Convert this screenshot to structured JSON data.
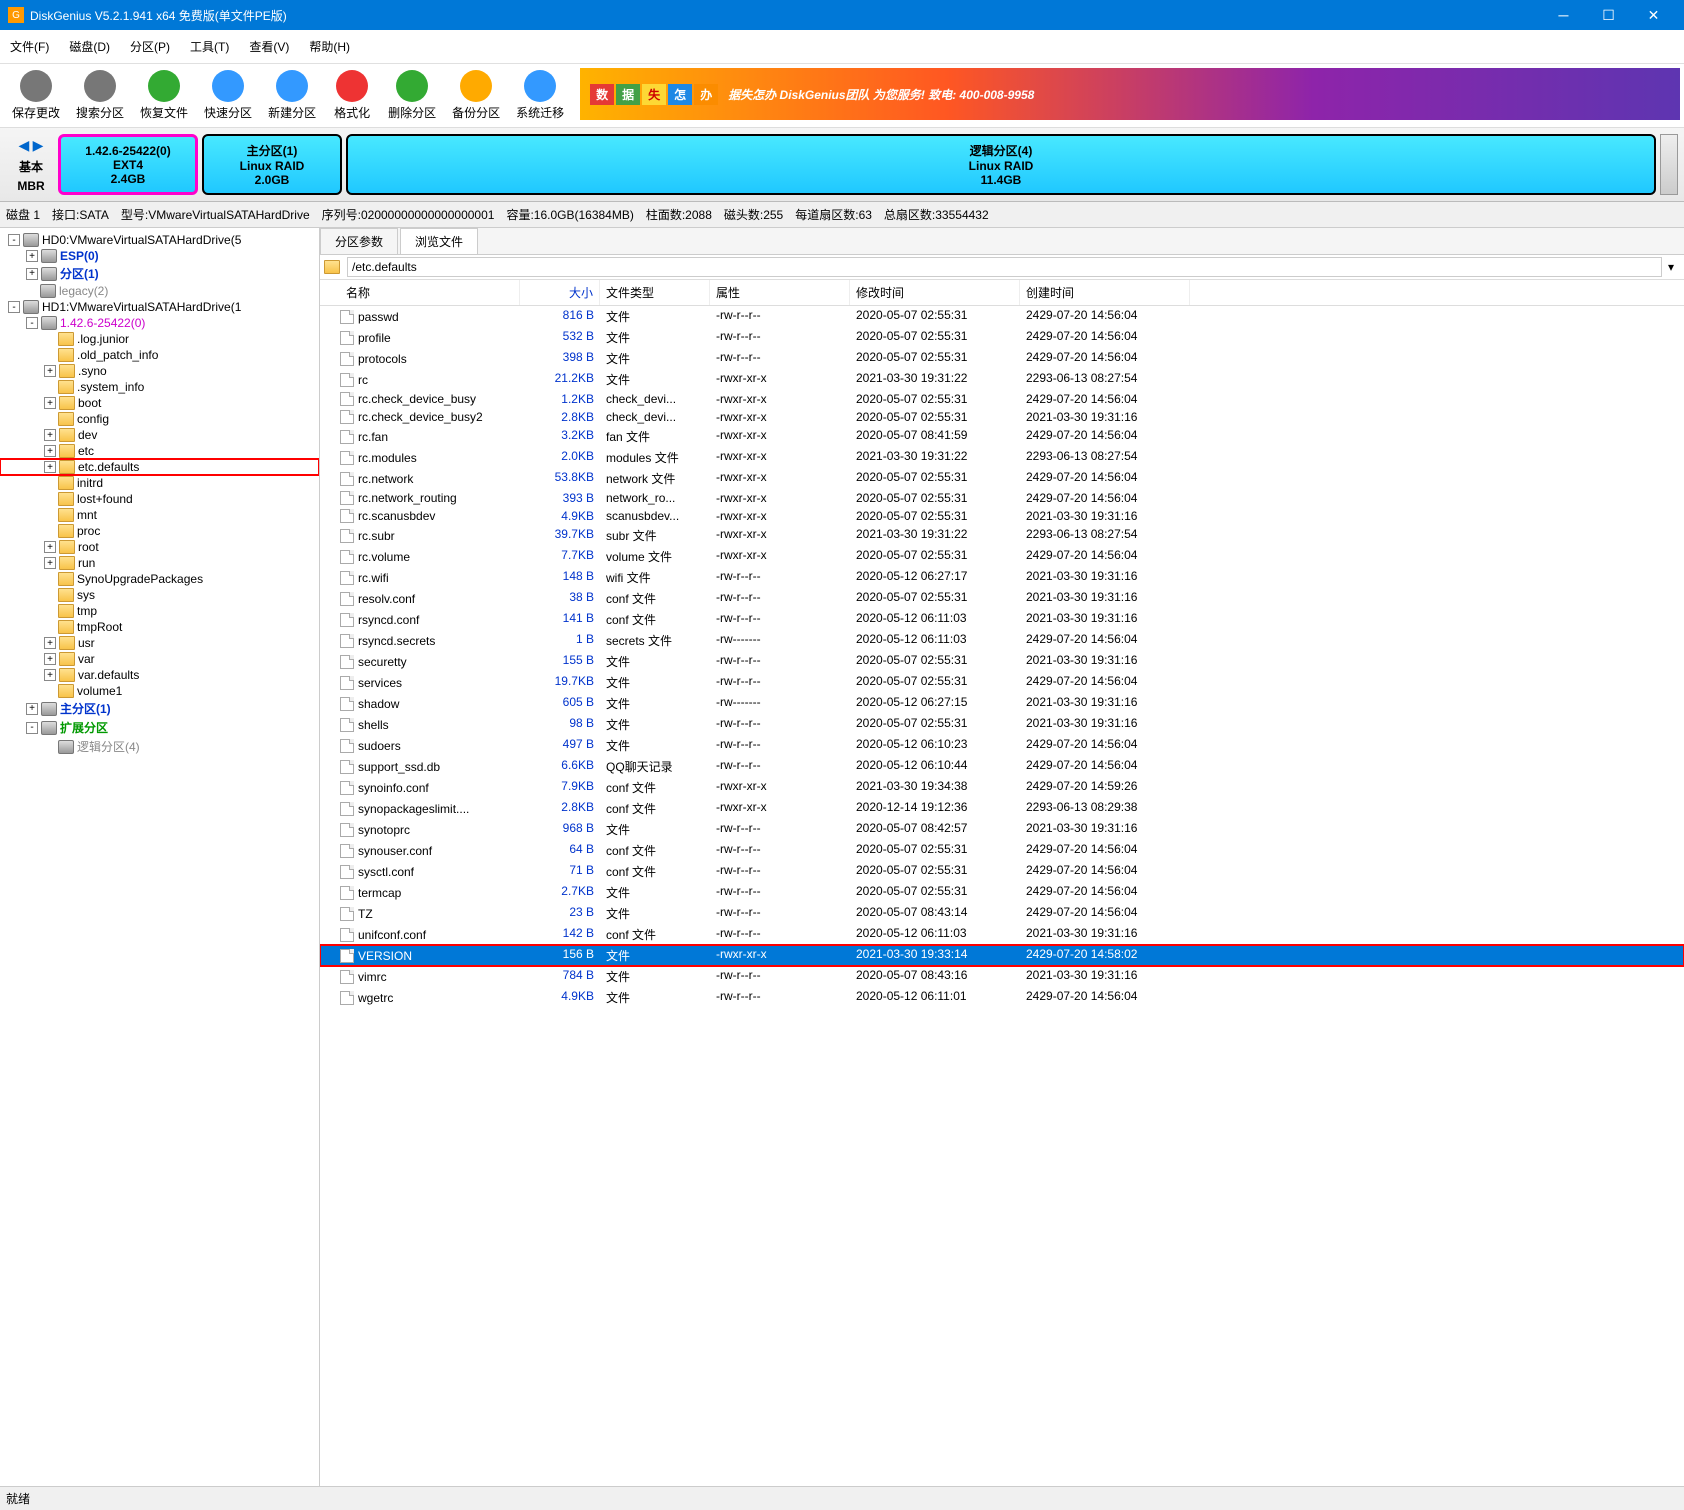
{
  "title": "DiskGenius V5.2.1.941 x64 免费版(单文件PE版)",
  "menu": [
    "文件(F)",
    "磁盘(D)",
    "分区(P)",
    "工具(T)",
    "查看(V)",
    "帮助(H)"
  ],
  "toolbar": [
    {
      "label": "保存更改",
      "icon": "save"
    },
    {
      "label": "搜索分区",
      "icon": "search"
    },
    {
      "label": "恢复文件",
      "icon": "recover"
    },
    {
      "label": "快速分区",
      "icon": "quickpart"
    },
    {
      "label": "新建分区",
      "icon": "newpart"
    },
    {
      "label": "格式化",
      "icon": "format"
    },
    {
      "label": "删除分区",
      "icon": "delete"
    },
    {
      "label": "备份分区",
      "icon": "backup"
    },
    {
      "label": "系统迁移",
      "icon": "migrate"
    }
  ],
  "banner_text": "据失怎办 DiskGenius团队 为您服务! 致电: 400-008-9958",
  "mbr_label_top": "基本",
  "mbr_label_bottom": "MBR",
  "partitions": [
    {
      "title": "1.42.6-25422(0)",
      "fs": "EXT4",
      "size": "2.4GB",
      "bg": "linear-gradient(#48e8ff,#20c8ff)",
      "border": "3px solid #ff00cc"
    },
    {
      "title": "主分区(1)",
      "fs": "Linux RAID",
      "size": "2.0GB",
      "bg": "linear-gradient(#48e8ff,#20c8ff)",
      "border": "2px solid #000",
      "flex": "0 0 140px"
    },
    {
      "title": "逻辑分区(4)",
      "fs": "Linux RAID",
      "size": "11.4GB",
      "bg": "linear-gradient(#48e8ff,#20c8ff)",
      "border": "2px solid #000",
      "flex": "1"
    }
  ],
  "diskbar": {
    "prefix": "磁盘 1",
    "interface": "接口:SATA",
    "model": "型号:VMwareVirtualSATAHardDrive",
    "serial": "序列号:02000000000000000001",
    "capacity": "容量:16.0GB(16384MB)",
    "cylinders": "柱面数:2088",
    "heads": "磁头数:255",
    "sectors_per_track": "每道扇区数:63",
    "total_sectors": "总扇区数:33554432"
  },
  "tree": [
    {
      "indent": 0,
      "exp": "-",
      "icon": "disk",
      "text": "HD0:VMwareVirtualSATAHardDrive(5",
      "cls": ""
    },
    {
      "indent": 1,
      "exp": "+",
      "icon": "disk",
      "text": "ESP(0)",
      "cls": "blue-txt"
    },
    {
      "indent": 1,
      "exp": "+",
      "icon": "disk",
      "text": "分区(1)",
      "cls": "blue-txt"
    },
    {
      "indent": 1,
      "exp": "",
      "icon": "disk",
      "text": "legacy(2)",
      "cls": "gray-txt"
    },
    {
      "indent": 0,
      "exp": "-",
      "icon": "disk",
      "text": "HD1:VMwareVirtualSATAHardDrive(1",
      "cls": ""
    },
    {
      "indent": 1,
      "exp": "-",
      "icon": "disk",
      "text": "1.42.6-25422(0)",
      "cls": "pink-txt"
    },
    {
      "indent": 2,
      "exp": "",
      "icon": "folder",
      "text": ".log.junior",
      "cls": ""
    },
    {
      "indent": 2,
      "exp": "",
      "icon": "folder",
      "text": ".old_patch_info",
      "cls": ""
    },
    {
      "indent": 2,
      "exp": "+",
      "icon": "folder",
      "text": ".syno",
      "cls": ""
    },
    {
      "indent": 2,
      "exp": "",
      "icon": "folder",
      "text": ".system_info",
      "cls": ""
    },
    {
      "indent": 2,
      "exp": "+",
      "icon": "folder",
      "text": "boot",
      "cls": ""
    },
    {
      "indent": 2,
      "exp": "",
      "icon": "folder",
      "text": "config",
      "cls": ""
    },
    {
      "indent": 2,
      "exp": "+",
      "icon": "folder",
      "text": "dev",
      "cls": ""
    },
    {
      "indent": 2,
      "exp": "+",
      "icon": "folder",
      "text": "etc",
      "cls": ""
    },
    {
      "indent": 2,
      "exp": "+",
      "icon": "folder",
      "text": "etc.defaults",
      "cls": "",
      "highlight": true
    },
    {
      "indent": 2,
      "exp": "",
      "icon": "folder",
      "text": "initrd",
      "cls": ""
    },
    {
      "indent": 2,
      "exp": "",
      "icon": "folder",
      "text": "lost+found",
      "cls": ""
    },
    {
      "indent": 2,
      "exp": "",
      "icon": "folder",
      "text": "mnt",
      "cls": ""
    },
    {
      "indent": 2,
      "exp": "",
      "icon": "folder",
      "text": "proc",
      "cls": ""
    },
    {
      "indent": 2,
      "exp": "+",
      "icon": "folder",
      "text": "root",
      "cls": ""
    },
    {
      "indent": 2,
      "exp": "+",
      "icon": "folder",
      "text": "run",
      "cls": ""
    },
    {
      "indent": 2,
      "exp": "",
      "icon": "folder",
      "text": "SynoUpgradePackages",
      "cls": ""
    },
    {
      "indent": 2,
      "exp": "",
      "icon": "folder",
      "text": "sys",
      "cls": ""
    },
    {
      "indent": 2,
      "exp": "",
      "icon": "folder",
      "text": "tmp",
      "cls": ""
    },
    {
      "indent": 2,
      "exp": "",
      "icon": "folder",
      "text": "tmpRoot",
      "cls": ""
    },
    {
      "indent": 2,
      "exp": "+",
      "icon": "folder",
      "text": "usr",
      "cls": ""
    },
    {
      "indent": 2,
      "exp": "+",
      "icon": "folder",
      "text": "var",
      "cls": ""
    },
    {
      "indent": 2,
      "exp": "+",
      "icon": "folder",
      "text": "var.defaults",
      "cls": ""
    },
    {
      "indent": 2,
      "exp": "",
      "icon": "folder",
      "text": "volume1",
      "cls": ""
    },
    {
      "indent": 1,
      "exp": "+",
      "icon": "disk",
      "text": "主分区(1)",
      "cls": "blue-txt"
    },
    {
      "indent": 1,
      "exp": "-",
      "icon": "disk",
      "text": "扩展分区",
      "cls": "green-txt"
    },
    {
      "indent": 2,
      "exp": "",
      "icon": "disk",
      "text": "逻辑分区(4)",
      "cls": "gray-txt"
    }
  ],
  "tabs": {
    "params": "分区参数",
    "browse": "浏览文件"
  },
  "path": "/etc.defaults",
  "columns": {
    "name": "名称",
    "size": "大小",
    "type": "文件类型",
    "attr": "属性",
    "mtime": "修改时间",
    "ctime": "创建时间"
  },
  "files": [
    {
      "name": "passwd",
      "size": "816 B",
      "type": "文件",
      "attr": "-rw-r--r--",
      "mtime": "2020-05-07 02:55:31",
      "ctime": "2429-07-20 14:56:04"
    },
    {
      "name": "profile",
      "size": "532 B",
      "type": "文件",
      "attr": "-rw-r--r--",
      "mtime": "2020-05-07 02:55:31",
      "ctime": "2429-07-20 14:56:04"
    },
    {
      "name": "protocols",
      "size": "398 B",
      "type": "文件",
      "attr": "-rw-r--r--",
      "mtime": "2020-05-07 02:55:31",
      "ctime": "2429-07-20 14:56:04"
    },
    {
      "name": "rc",
      "size": "21.2KB",
      "type": "文件",
      "attr": "-rwxr-xr-x",
      "mtime": "2021-03-30 19:31:22",
      "ctime": "2293-06-13 08:27:54"
    },
    {
      "name": "rc.check_device_busy",
      "size": "1.2KB",
      "type": "check_devi...",
      "attr": "-rwxr-xr-x",
      "mtime": "2020-05-07 02:55:31",
      "ctime": "2429-07-20 14:56:04"
    },
    {
      "name": "rc.check_device_busy2",
      "size": "2.8KB",
      "type": "check_devi...",
      "attr": "-rwxr-xr-x",
      "mtime": "2020-05-07 02:55:31",
      "ctime": "2021-03-30 19:31:16"
    },
    {
      "name": "rc.fan",
      "size": "3.2KB",
      "type": "fan 文件",
      "attr": "-rwxr-xr-x",
      "mtime": "2020-05-07 08:41:59",
      "ctime": "2429-07-20 14:56:04"
    },
    {
      "name": "rc.modules",
      "size": "2.0KB",
      "type": "modules 文件",
      "attr": "-rwxr-xr-x",
      "mtime": "2021-03-30 19:31:22",
      "ctime": "2293-06-13 08:27:54"
    },
    {
      "name": "rc.network",
      "size": "53.8KB",
      "type": "network 文件",
      "attr": "-rwxr-xr-x",
      "mtime": "2020-05-07 02:55:31",
      "ctime": "2429-07-20 14:56:04"
    },
    {
      "name": "rc.network_routing",
      "size": "393 B",
      "type": "network_ro...",
      "attr": "-rwxr-xr-x",
      "mtime": "2020-05-07 02:55:31",
      "ctime": "2429-07-20 14:56:04"
    },
    {
      "name": "rc.scanusbdev",
      "size": "4.9KB",
      "type": "scanusbdev...",
      "attr": "-rwxr-xr-x",
      "mtime": "2020-05-07 02:55:31",
      "ctime": "2021-03-30 19:31:16"
    },
    {
      "name": "rc.subr",
      "size": "39.7KB",
      "type": "subr 文件",
      "attr": "-rwxr-xr-x",
      "mtime": "2021-03-30 19:31:22",
      "ctime": "2293-06-13 08:27:54"
    },
    {
      "name": "rc.volume",
      "size": "7.7KB",
      "type": "volume 文件",
      "attr": "-rwxr-xr-x",
      "mtime": "2020-05-07 02:55:31",
      "ctime": "2429-07-20 14:56:04"
    },
    {
      "name": "rc.wifi",
      "size": "148 B",
      "type": "wifi 文件",
      "attr": "-rw-r--r--",
      "mtime": "2020-05-12 06:27:17",
      "ctime": "2021-03-30 19:31:16"
    },
    {
      "name": "resolv.conf",
      "size": "38 B",
      "type": "conf 文件",
      "attr": "-rw-r--r--",
      "mtime": "2020-05-07 02:55:31",
      "ctime": "2021-03-30 19:31:16"
    },
    {
      "name": "rsyncd.conf",
      "size": "141 B",
      "type": "conf 文件",
      "attr": "-rw-r--r--",
      "mtime": "2020-05-12 06:11:03",
      "ctime": "2021-03-30 19:31:16"
    },
    {
      "name": "rsyncd.secrets",
      "size": "1 B",
      "type": "secrets 文件",
      "attr": "-rw-------",
      "mtime": "2020-05-12 06:11:03",
      "ctime": "2429-07-20 14:56:04"
    },
    {
      "name": "securetty",
      "size": "155 B",
      "type": "文件",
      "attr": "-rw-r--r--",
      "mtime": "2020-05-07 02:55:31",
      "ctime": "2021-03-30 19:31:16"
    },
    {
      "name": "services",
      "size": "19.7KB",
      "type": "文件",
      "attr": "-rw-r--r--",
      "mtime": "2020-05-07 02:55:31",
      "ctime": "2429-07-20 14:56:04"
    },
    {
      "name": "shadow",
      "size": "605 B",
      "type": "文件",
      "attr": "-rw-------",
      "mtime": "2020-05-12 06:27:15",
      "ctime": "2021-03-30 19:31:16"
    },
    {
      "name": "shells",
      "size": "98 B",
      "type": "文件",
      "attr": "-rw-r--r--",
      "mtime": "2020-05-07 02:55:31",
      "ctime": "2021-03-30 19:31:16"
    },
    {
      "name": "sudoers",
      "size": "497 B",
      "type": "文件",
      "attr": "-rw-r--r--",
      "mtime": "2020-05-12 06:10:23",
      "ctime": "2429-07-20 14:56:04"
    },
    {
      "name": "support_ssd.db",
      "size": "6.6KB",
      "type": "QQ聊天记录",
      "attr": "-rw-r--r--",
      "mtime": "2020-05-12 06:10:44",
      "ctime": "2429-07-20 14:56:04"
    },
    {
      "name": "synoinfo.conf",
      "size": "7.9KB",
      "type": "conf 文件",
      "attr": "-rwxr-xr-x",
      "mtime": "2021-03-30 19:34:38",
      "ctime": "2429-07-20 14:59:26"
    },
    {
      "name": "synopackageslimit....",
      "size": "2.8KB",
      "type": "conf 文件",
      "attr": "-rwxr-xr-x",
      "mtime": "2020-12-14 19:12:36",
      "ctime": "2293-06-13 08:29:38"
    },
    {
      "name": "synotoprc",
      "size": "968 B",
      "type": "文件",
      "attr": "-rw-r--r--",
      "mtime": "2020-05-07 08:42:57",
      "ctime": "2021-03-30 19:31:16"
    },
    {
      "name": "synouser.conf",
      "size": "64 B",
      "type": "conf 文件",
      "attr": "-rw-r--r--",
      "mtime": "2020-05-07 02:55:31",
      "ctime": "2429-07-20 14:56:04"
    },
    {
      "name": "sysctl.conf",
      "size": "71 B",
      "type": "conf 文件",
      "attr": "-rw-r--r--",
      "mtime": "2020-05-07 02:55:31",
      "ctime": "2429-07-20 14:56:04"
    },
    {
      "name": "termcap",
      "size": "2.7KB",
      "type": "文件",
      "attr": "-rw-r--r--",
      "mtime": "2020-05-07 02:55:31",
      "ctime": "2429-07-20 14:56:04"
    },
    {
      "name": "TZ",
      "size": "23 B",
      "type": "文件",
      "attr": "-rw-r--r--",
      "mtime": "2020-05-07 08:43:14",
      "ctime": "2429-07-20 14:56:04"
    },
    {
      "name": "unifconf.conf",
      "size": "142 B",
      "type": "conf 文件",
      "attr": "-rw-r--r--",
      "mtime": "2020-05-12 06:11:03",
      "ctime": "2021-03-30 19:31:16"
    },
    {
      "name": "VERSION",
      "size": "156 B",
      "type": "文件",
      "attr": "-rwxr-xr-x",
      "mtime": "2021-03-30 19:33:14",
      "ctime": "2429-07-20 14:58:02",
      "selected": true,
      "highlight": true
    },
    {
      "name": "vimrc",
      "size": "784 B",
      "type": "文件",
      "attr": "-rw-r--r--",
      "mtime": "2020-05-07 08:43:16",
      "ctime": "2021-03-30 19:31:16"
    },
    {
      "name": "wgetrc",
      "size": "4.9KB",
      "type": "文件",
      "attr": "-rw-r--r--",
      "mtime": "2020-05-12 06:11:01",
      "ctime": "2429-07-20 14:56:04"
    }
  ],
  "statusbar": "就绪"
}
